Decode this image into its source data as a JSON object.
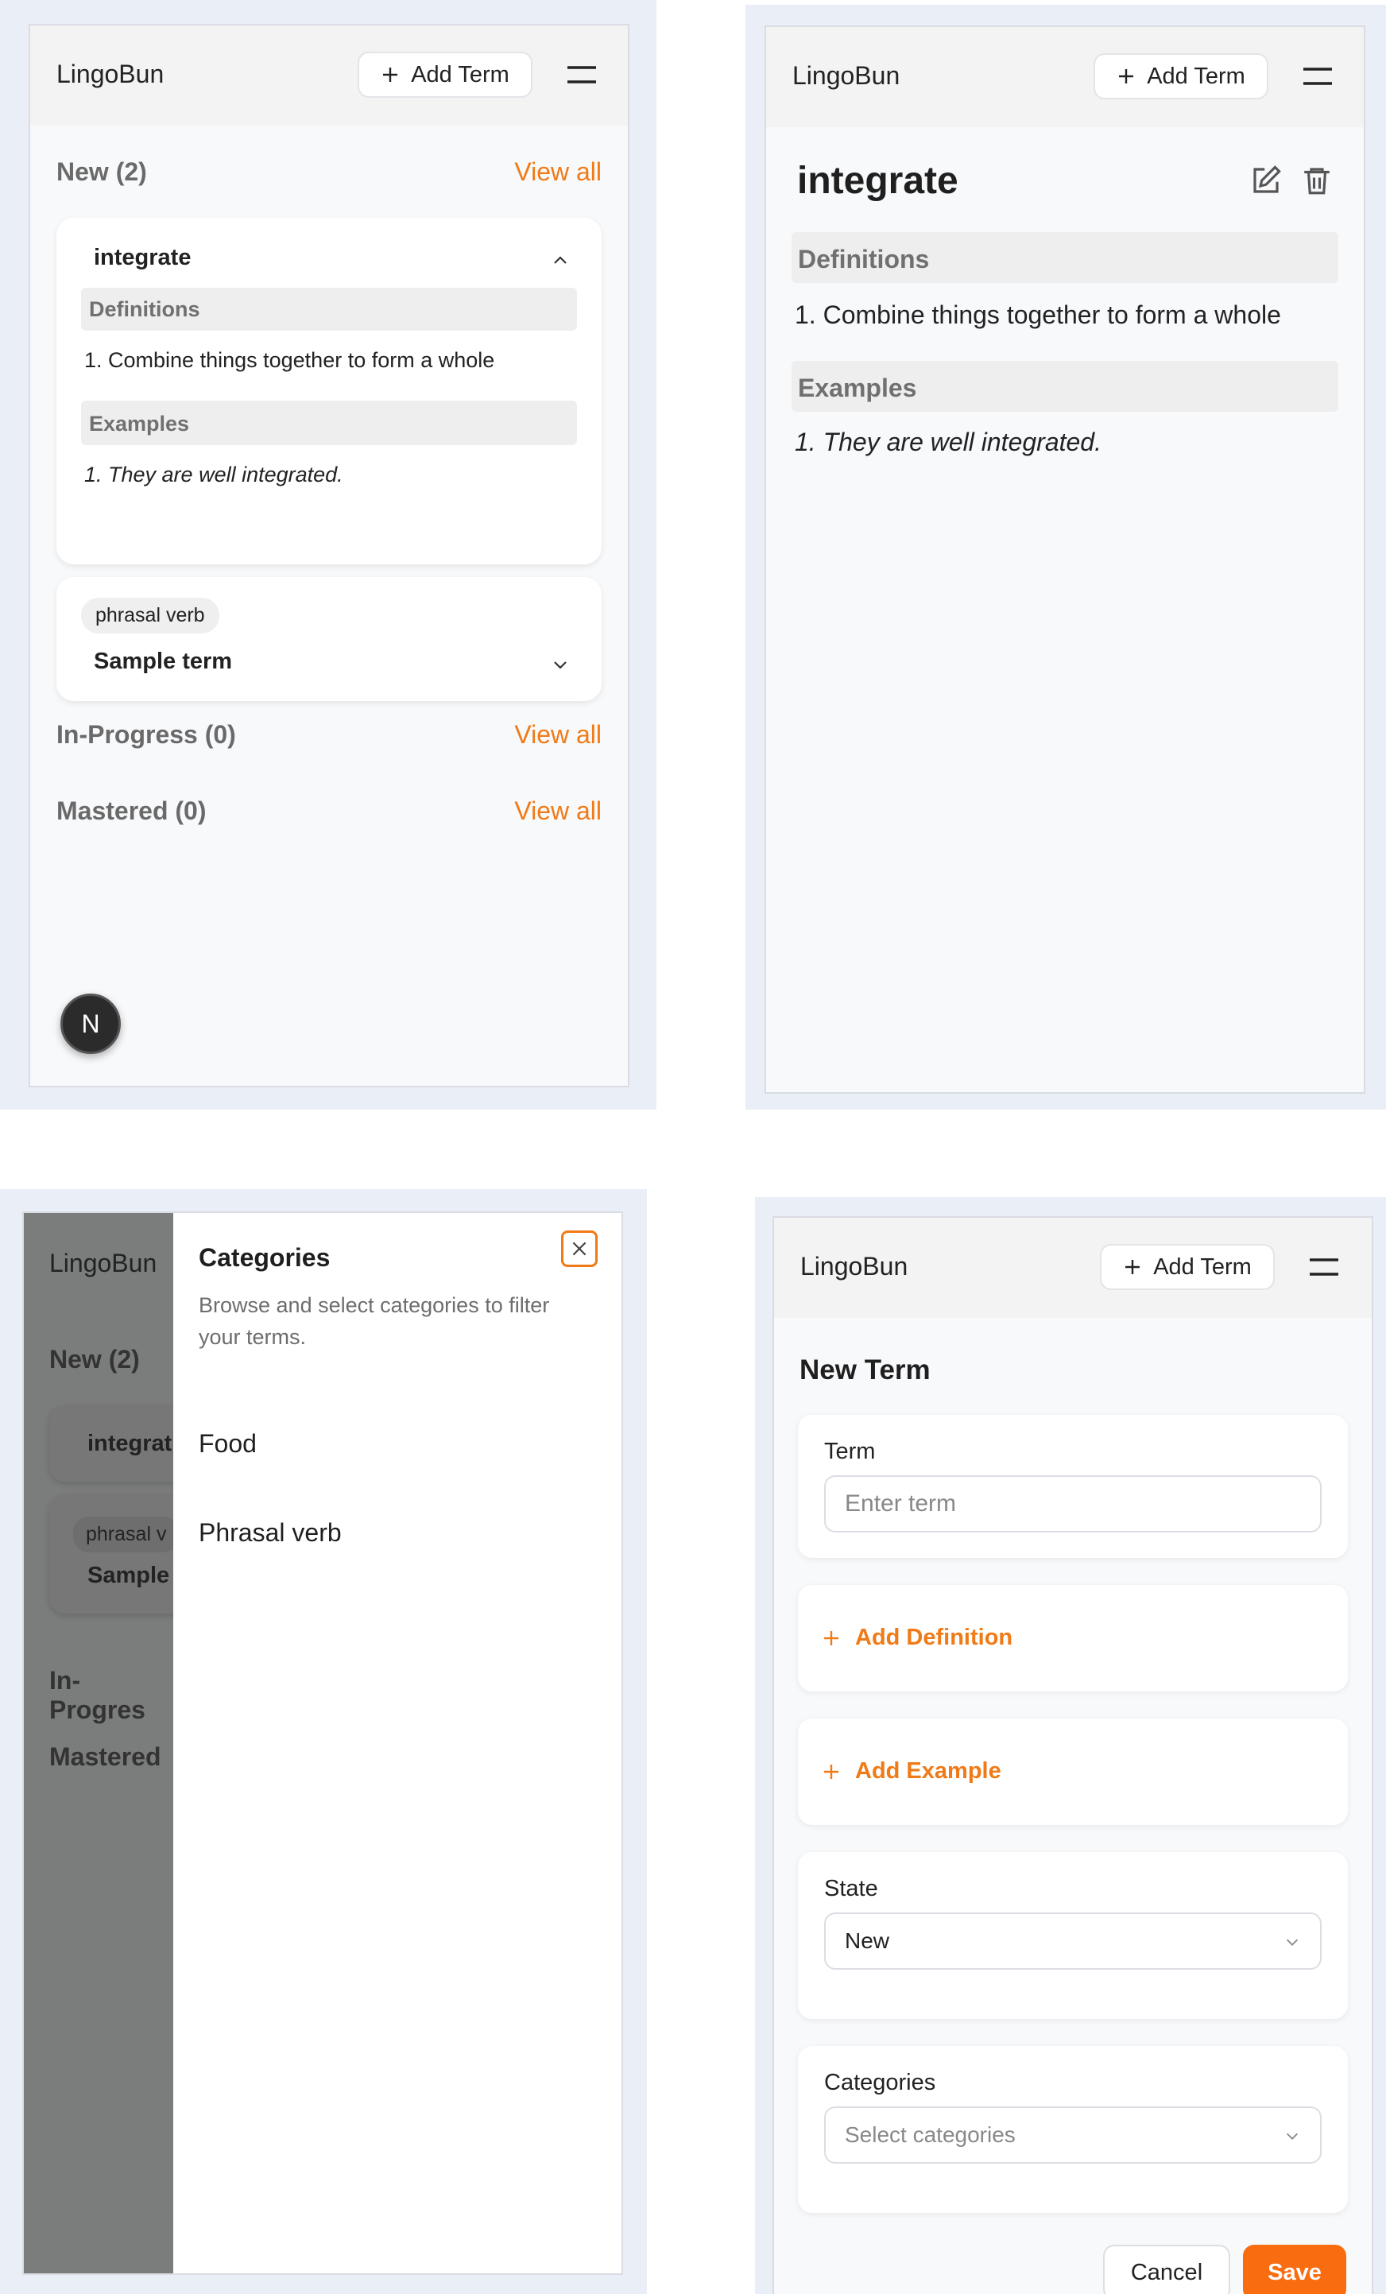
{
  "app": {
    "title": "LingoBun",
    "add_term_label": "Add Term"
  },
  "home": {
    "new_heading": "New (2)",
    "in_progress_heading": "In-Progress (0)",
    "mastered_heading": "Mastered (0)",
    "view_all_label": "View all",
    "expanded_card": {
      "term": "integrate",
      "definitions_label": "Definitions",
      "definition_1": "1. Combine things together to form a whole",
      "examples_label": "Examples",
      "example_1": "1. They are well integrated."
    },
    "collapsed_card": {
      "badge": "phrasal verb",
      "term": "Sample term"
    },
    "avatar_letter": "N"
  },
  "detail": {
    "term": "integrate",
    "definitions_label": "Definitions",
    "definition_1": "1. Combine things together to form a whole",
    "examples_label": "Examples",
    "example_1": "1. They are well integrated."
  },
  "drawer": {
    "title": "Categories",
    "description": "Browse and select categories to filter your terms.",
    "categories": [
      "Food",
      "Phrasal verb"
    ],
    "behind": {
      "new_heading": "New (2)",
      "card1_term": "integrat",
      "card2_badge": "phrasal v",
      "card2_term": "Sample",
      "in_progress_heading": "In-Progres",
      "mastered_heading": "Mastered"
    }
  },
  "form": {
    "heading": "New Term",
    "term_label": "Term",
    "term_placeholder": "Enter term",
    "add_definition_label": "Add Definition",
    "add_example_label": "Add Example",
    "state_label": "State",
    "state_value": "New",
    "categories_label": "Categories",
    "categories_placeholder": "Select categories",
    "cancel_label": "Cancel",
    "save_label": "Save"
  },
  "colors": {
    "accent": "#f07a16",
    "background_panel": "#eaeef6"
  }
}
